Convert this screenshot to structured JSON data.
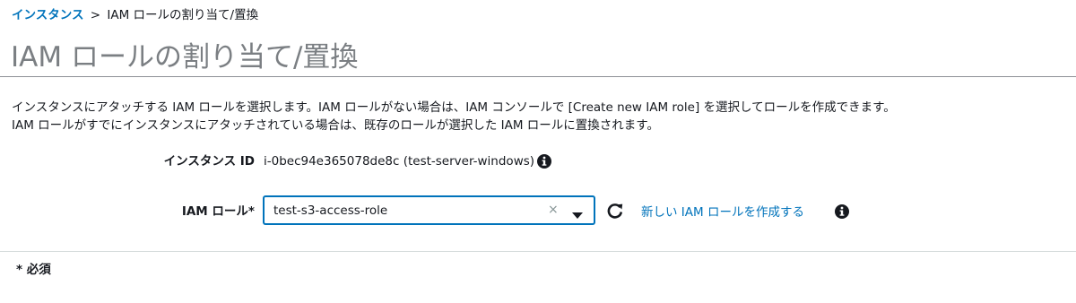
{
  "breadcrumb": {
    "link_label": "インスタンス",
    "separator": ">",
    "current_label": "IAM ロールの割り当て/置換"
  },
  "page": {
    "title": "IAM ロールの割り当て/置換"
  },
  "description": {
    "line1": "インスタンスにアタッチする IAM ロールを選択します。IAM ロールがない場合は、IAM コンソールで [Create new IAM role] を選択してロールを作成できます。",
    "line2": "IAM ロールがすでにインスタンスにアタッチされている場合は、既存のロールが選択した IAM ロールに置換されます。"
  },
  "form": {
    "instance_id_label": "インスタンス ID",
    "instance_id_value": "i-0bec94e365078de8c (test-server-windows)",
    "iam_role_label": "IAM ロール*",
    "iam_role_selected": "test-s3-access-role",
    "clear_glyph": "×",
    "create_role_link": "新しい IAM ロールを作成する"
  },
  "footer": {
    "required_note": "* 必須"
  },
  "icons": {
    "info": "info-icon",
    "refresh": "refresh-icon",
    "caret": "caret-down-icon",
    "clear": "clear-icon"
  },
  "colors": {
    "link": "#0073bb",
    "title": "#7b7f83",
    "focus_border": "#0073bb"
  }
}
